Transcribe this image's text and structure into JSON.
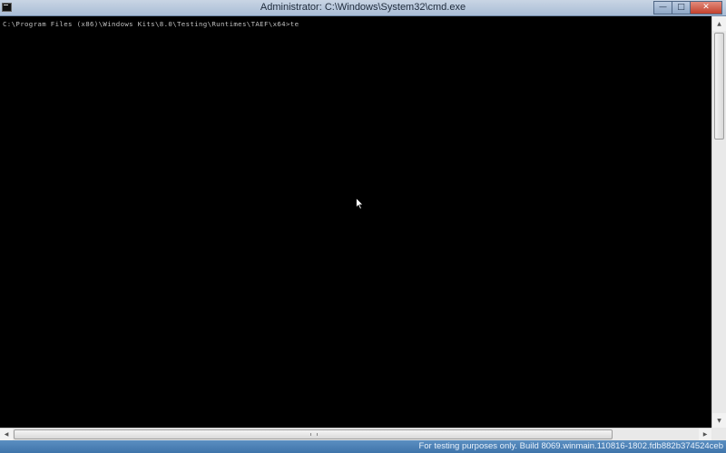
{
  "window": {
    "title": "Administrator: C:\\Windows\\System32\\cmd.exe",
    "icon": "cmd-icon"
  },
  "caption": {
    "minimize_glyph": "—",
    "maximize_glyph": "□",
    "close_glyph": "✕"
  },
  "console": {
    "lines": [
      "C:\\Program Files (x86)\\Windows Kits\\8.0\\Testing\\Runtimes\\TAEF\\x64>te"
    ],
    "background": "#000000",
    "foreground": "#c0c0c0"
  },
  "scrollbars": {
    "up_glyph": "▲",
    "down_glyph": "▼",
    "left_glyph": "◀",
    "right_glyph": "▶"
  },
  "taskbar": {
    "watermark": "For testing purposes only. Build 8069.winmain.110816-1802.fdb882b374524ceb"
  }
}
